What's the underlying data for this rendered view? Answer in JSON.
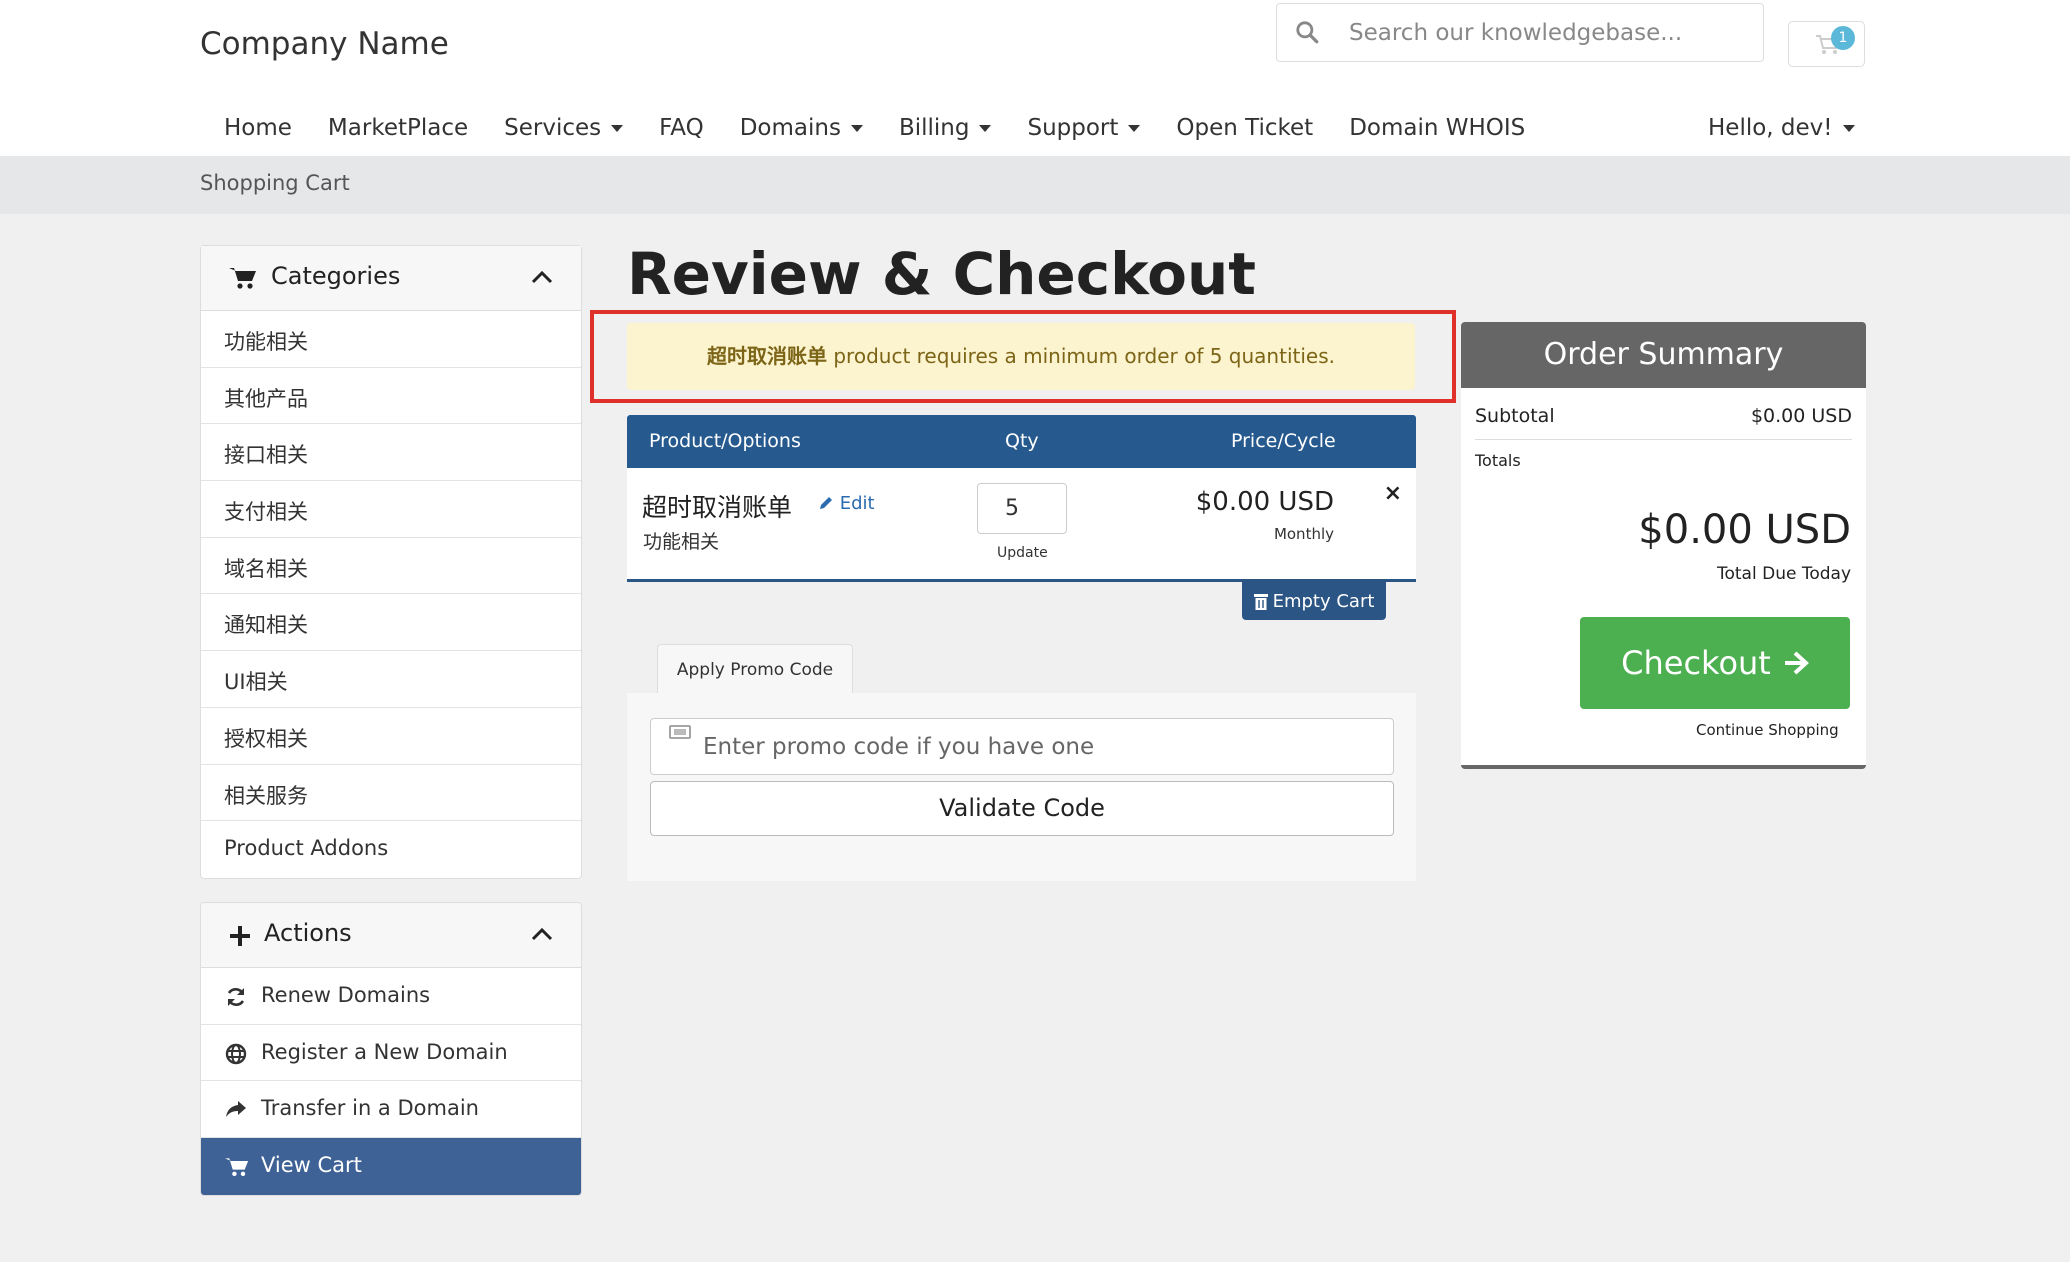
{
  "header": {
    "brand": "Company Name",
    "search_placeholder": "Search our knowledgebase...",
    "cart_count": "1"
  },
  "nav": {
    "items": [
      "Home",
      "MarketPlace",
      "Services",
      "FAQ",
      "Domains",
      "Billing",
      "Support",
      "Open Ticket",
      "Domain WHOIS"
    ],
    "user": "Hello, dev!"
  },
  "breadcrumb": "Shopping Cart",
  "categories": {
    "title": "Categories",
    "items": [
      "功能相关",
      "其他产品",
      "接口相关",
      "支付相关",
      "域名相关",
      "通知相关",
      "UI相关",
      "授权相关",
      "相关服务",
      "Product Addons"
    ]
  },
  "actions": {
    "title": "Actions",
    "items": [
      "Renew Domains",
      "Register a New Domain",
      "Transfer in a Domain",
      "View Cart"
    ]
  },
  "main": {
    "title": "Review & Checkout",
    "alert_product": "超时取消账单",
    "alert_text": " product requires a minimum order of 5 quantities.",
    "table_headers": [
      "Product/Options",
      "Qty",
      "Price/Cycle"
    ],
    "product_name": "超时取消账单",
    "edit_label": "Edit",
    "product_group": "功能相关",
    "qty": "5",
    "update_label": "Update",
    "price": "$0.00 USD",
    "cycle": "Monthly",
    "remove": "×",
    "empty_cart": "Empty Cart",
    "promo_tab": "Apply Promo Code",
    "promo_placeholder": "Enter promo code if you have one",
    "validate_label": "Validate Code"
  },
  "summary": {
    "title": "Order Summary",
    "subtotal_label": "Subtotal",
    "subtotal_value": "$0.00 USD",
    "totals_label": "Totals",
    "total": "$0.00 USD",
    "due_label": "Total Due Today",
    "checkout_label": "Checkout",
    "continue_label": "Continue Shopping"
  },
  "colors": {
    "nav_blue": "#265a8f",
    "active_item": "#3f6296",
    "checkout_green": "#4caf50",
    "alert_bg": "#fcf3cf",
    "highlight_red": "#e0302a"
  }
}
